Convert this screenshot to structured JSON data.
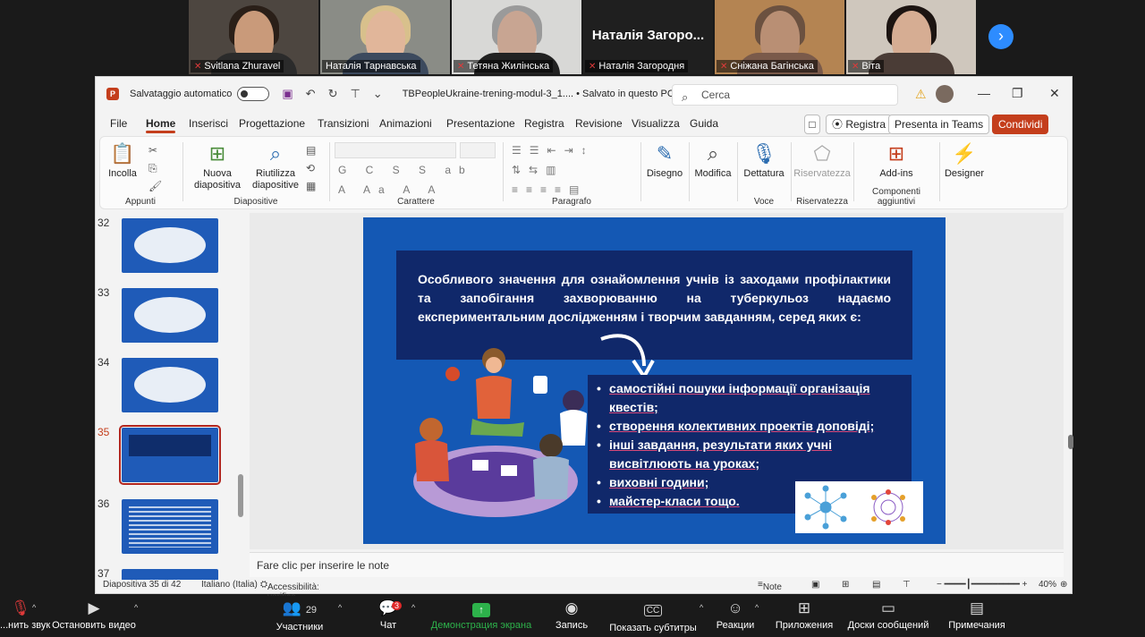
{
  "participants": [
    {
      "name": "Svitlana Zhuravel"
    },
    {
      "name": "Наталія Тарнавська"
    },
    {
      "name": "Тетяна Жилінська"
    },
    {
      "name": "Наталія Загородня",
      "big_label": "Наталія Загоро..."
    },
    {
      "name": "Сніжана Багінська"
    },
    {
      "name": "Віта"
    }
  ],
  "ppt": {
    "autosave_label": "Salvataggio automatico",
    "doc_title": "TBPeopleUkraine-trening-modul-3_1....  •  Salvato in questo PC ⌵",
    "search_placeholder": "Cerca",
    "tabs": [
      "File",
      "Home",
      "Inserisci",
      "Progettazione",
      "Transizioni",
      "Animazioni",
      "Presentazione",
      "Registra",
      "Revisione",
      "Visualizza",
      "Guida"
    ],
    "active_tab": "Home",
    "record_btn": "⦿ Registra",
    "teams_btn": "Presenta in Teams",
    "share_btn": "Condividi",
    "ribbon": {
      "paste": "Incolla",
      "new_slide": "Nuova",
      "new_slide2": "diapositiva",
      "reuse": "Riutilizza",
      "reuse2": "diapositive",
      "draw": "Disegno",
      "edit": "Modifica",
      "dictate": "Dettatura",
      "privacy": "Riservatezza",
      "addins": "Add-ins",
      "designer": "Designer",
      "groups": [
        "Appunti",
        "Diapositive",
        "Carattere",
        "Paragrafo",
        "Voce",
        "Riservatezza",
        "Componenti aggiuntivi"
      ],
      "font_buttons": "G C S S ab",
      "font_row2": "A Aa A A"
    },
    "thumb_numbers": [
      "32",
      "33",
      "34",
      "35",
      "36",
      "37"
    ],
    "active_slide_num": "35",
    "slide": {
      "intro_text": "Особливого значення для ознайомлення учнів із заходами профілактики та запобігання захворюванню на туберкульоз надаємо експериментальним дослідженням і творчим завданням, серед яких є:",
      "list_items": [
        "самостійні пошуки інформації організація квестів;",
        "створення колективних проектів доповіді;",
        "інші завдання, результати яких учні висвітлюють на уроках;",
        "виховні години;",
        "майстер-класи тощо."
      ]
    },
    "notes_placeholder": "Fare clic per inserire le note",
    "status": {
      "slide_pos": "Diapositiva 35 di 42",
      "language": "Italiano (Italia)",
      "accessibility": "Accessibilità: verifica",
      "notes": "Note",
      "zoom": "40%"
    }
  },
  "zoom_bar": {
    "mute": "...нить звук",
    "stop_video": "Остановить видео",
    "participants_count": "29",
    "participants": "Участники",
    "chat_badge": "3",
    "chat": "Чат",
    "share_screen": "Демонстрация экрана",
    "record": "Запись",
    "captions": "Показать субтитры",
    "reactions": "Реакции",
    "apps": "Приложения",
    "whiteboards": "Доски сообщений",
    "notes": "Примечания",
    "cc_icon": "CC"
  },
  "colors": {
    "ppt_accent": "#c43e1c",
    "slide_bg": "#1458b4",
    "box_bg": "#10286a",
    "zoom_green": "#2db24b"
  }
}
